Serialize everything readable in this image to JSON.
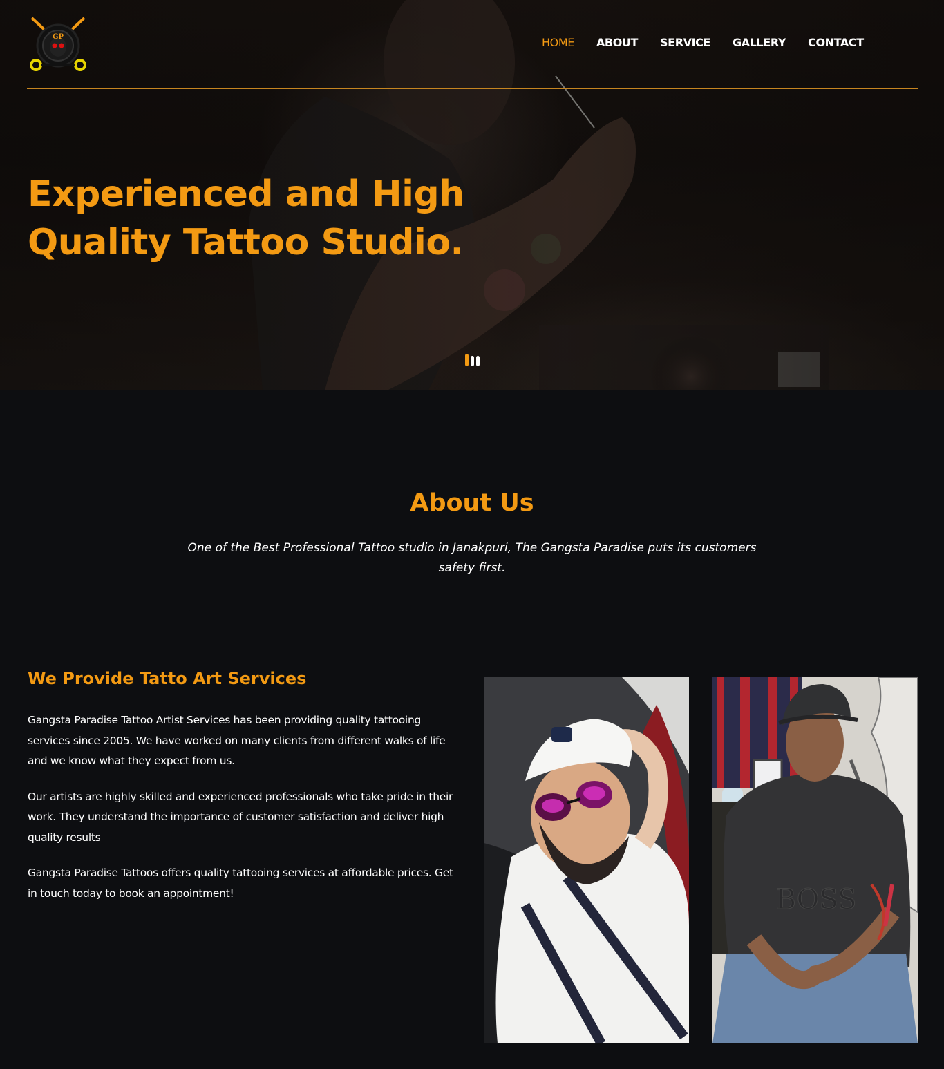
{
  "header": {
    "logo_name": "gangsta-paradise-logo",
    "nav": [
      {
        "label": "HOME",
        "active": true
      },
      {
        "label": "ABOUT",
        "active": false
      },
      {
        "label": "SERVICE",
        "active": false
      },
      {
        "label": "GALLERY",
        "active": false
      },
      {
        "label": "CONTACT",
        "active": false
      }
    ]
  },
  "hero": {
    "title": "Experienced and High Quality Tattoo Studio.",
    "slides_count": 3,
    "active_slide": 1
  },
  "about": {
    "title": "About Us",
    "subtitle": "One of the Best Professional Tattoo studio in Janakpuri, The Gangsta Paradise puts its customers safety first."
  },
  "services": {
    "title": "We Provide Tatto Art Services",
    "paragraphs": [
      "Gangsta Paradise Tattoo Artist Services has been providing quality tattooing services since 2005. We have worked on many clients from different walks of life and we know what they expect from us.",
      "Our artists are highly skilled and experienced professionals who take pride in their work. They understand the importance of customer satisfaction and deliver high quality results",
      "Gangsta Paradise Tattoos offers quality tattooing services at affordable prices. Get in touch today to book an appointment!"
    ]
  },
  "colors": {
    "accent": "#f39a13",
    "background": "#0d0e11",
    "text": "#ffffff"
  }
}
